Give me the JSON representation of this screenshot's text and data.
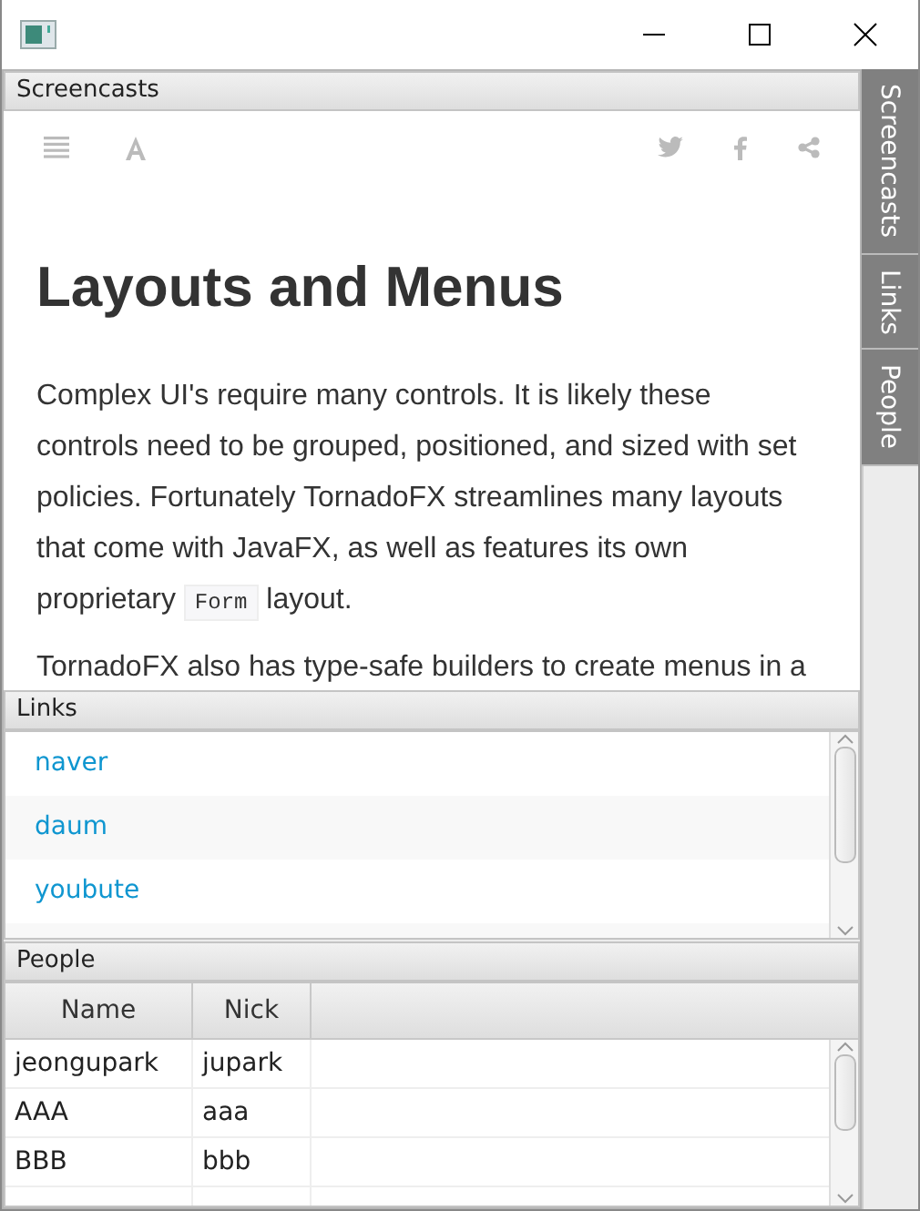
{
  "drawer_tabs": [
    {
      "label": "Screencasts"
    },
    {
      "label": "Links"
    },
    {
      "label": "People"
    }
  ],
  "screencasts": {
    "title": "Screencasts",
    "article": {
      "heading": "Layouts and Menus",
      "paragraphs": [
        {
          "parts": [
            {
              "kind": "text",
              "text": "Complex UI's require many controls. It is likely these controls need to be grouped, positioned, and sized with set policies. Fortunately TornadoFX streamlines many layouts that come with JavaFX, as well as features its own proprietary "
            },
            {
              "kind": "code",
              "text": "Form"
            },
            {
              "kind": "text",
              "text": " layout."
            }
          ]
        },
        {
          "parts": [
            {
              "kind": "text",
              "text": "TornadoFX also has type-safe builders to create menus in a"
            }
          ]
        }
      ]
    }
  },
  "links": {
    "title": "Links",
    "items": [
      "naver",
      "daum",
      "youbute"
    ]
  },
  "people": {
    "title": "People",
    "columns": [
      "Name",
      "Nick"
    ],
    "rows": [
      [
        "jeongupark",
        "jupark"
      ],
      [
        "AAA",
        "aaa"
      ],
      [
        "BBB",
        "bbb"
      ]
    ]
  }
}
